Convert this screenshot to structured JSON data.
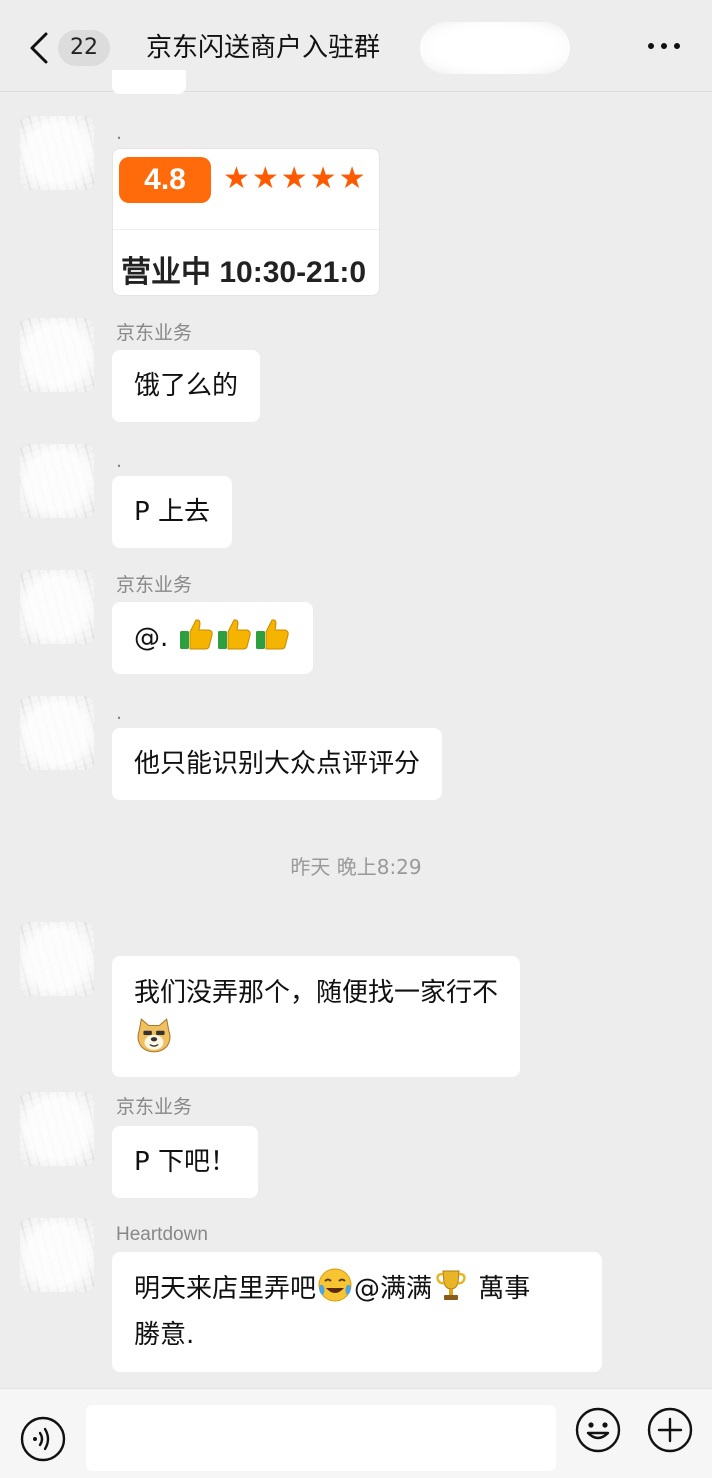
{
  "header": {
    "unread_count": "22",
    "title": "京东闪送商户入驻群"
  },
  "messages": [
    {
      "sender": ".",
      "type": "image",
      "image": {
        "rating": "4.8",
        "stars": "★★★★★",
        "hours": "营业中 10:30-21:0"
      }
    },
    {
      "sender": "京东业务",
      "text": "饿了么的"
    },
    {
      "sender": ".",
      "text": "P 上去"
    },
    {
      "sender": "京东业务",
      "text": "@. ",
      "emoji": [
        "thumbs-up",
        "thumbs-up",
        "thumbs-up"
      ]
    },
    {
      "sender": ".",
      "text": "他只能识别大众点评评分"
    },
    {
      "sender": "",
      "text_line1": "我们没弄那个，随便找一家行不",
      "emoji_line2": "doge"
    },
    {
      "sender": "京东业务",
      "text": "P 下吧！"
    },
    {
      "sender": "Heartdown",
      "text_part1": "明天来店里弄吧",
      "emoji1": "crying-laughing",
      "text_part2": "@满满",
      "emoji2": "trophy",
      "text_part3": " 萬事",
      "text_line2": "勝意."
    }
  ],
  "timestamp": "昨天 晚上8:29",
  "input": {
    "value": ""
  },
  "icons": {
    "back": "chevron-left-icon",
    "more": "more-icon",
    "voice": "voice-icon",
    "emoji": "emoji-icon",
    "plus": "plus-icon"
  },
  "colors": {
    "background": "#ededed",
    "bubble": "#ffffff",
    "rating_orange": "#ff6a0b"
  }
}
